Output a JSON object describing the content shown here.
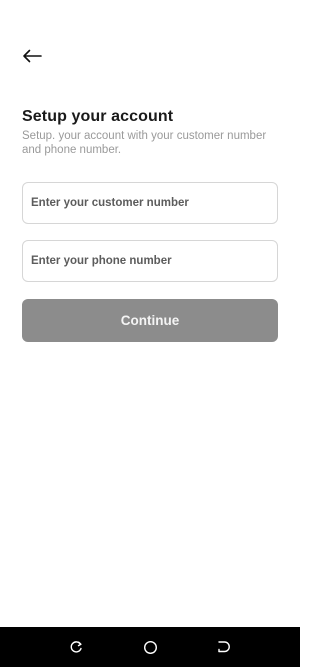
{
  "header": {
    "back_icon": "arrow-left-icon"
  },
  "content": {
    "title": "Setup your account",
    "subtitle": "Setup. your account with your customer number and phone number."
  },
  "form": {
    "customer_number": {
      "value": "",
      "placeholder": "Enter your customer number"
    },
    "phone_number": {
      "value": "",
      "placeholder": "Enter your phone number"
    },
    "continue_label": "Continue"
  },
  "system_nav": {
    "recent_icon": "recent-apps-icon",
    "home_icon": "home-icon",
    "back_icon": "system-back-icon"
  },
  "colors": {
    "background": "#ffffff",
    "title": "#1a1a1a",
    "subtitle": "#9a9a9a",
    "field_border": "#d6d6d6",
    "button_disabled": "#8c8c8c",
    "navbar": "#000000"
  }
}
